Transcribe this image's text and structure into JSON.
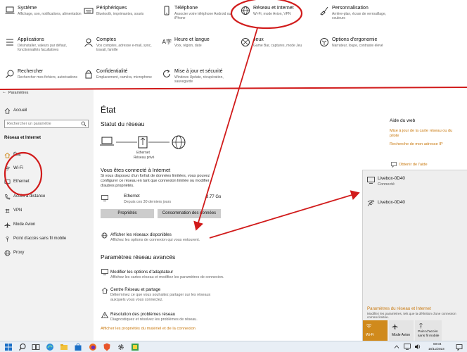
{
  "top_tiles": [
    {
      "title": "Système",
      "desc": "Affichage, son, notifications, alimentation",
      "icon": "laptop-icon"
    },
    {
      "title": "Périphériques",
      "desc": "Bluetooth, imprimantes, souris",
      "icon": "keyboard-icon"
    },
    {
      "title": "Téléphone",
      "desc": "Associer votre téléphone Android ou iPhone",
      "icon": "phone-icon"
    },
    {
      "title": "Réseau et Internet",
      "desc": "Wi-Fi, mode Avion, VPN",
      "icon": "globe-icon"
    },
    {
      "title": "Personnalisation",
      "desc": "Arrière-plan, écran de verrouillage, couleurs",
      "icon": "paintbrush-icon"
    },
    {
      "title": "Applications",
      "desc": "Désinstaller, valeurs par défaut, fonctionnalités facultatives",
      "icon": "apps-icon"
    },
    {
      "title": "Comptes",
      "desc": "Vos comptes, adresse e-mail, sync, travail, famille",
      "icon": "person-icon"
    },
    {
      "title": "Heure et langue",
      "desc": "Voix, région, date",
      "icon": "time-language-icon"
    },
    {
      "title": "Jeux",
      "desc": "Game Bar, captures, mode Jeu",
      "icon": "xbox-icon"
    },
    {
      "title": "Options d'ergonomie",
      "desc": "Narrateur, loupe, contraste élevé",
      "icon": "ease-of-access-icon"
    },
    {
      "title": "Rechercher",
      "desc": "Rechercher mes fichiers, autorisations",
      "icon": "search-icon"
    },
    {
      "title": "Confidentialité",
      "desc": "Emplacement, caméra, microphone",
      "icon": "lock-icon"
    },
    {
      "title": "Mise à jour et sécurité",
      "desc": "Windows Update, récupération, sauvegarde",
      "icon": "refresh-icon"
    }
  ],
  "window": {
    "title": "Paramètres",
    "home_label": "Accueil",
    "search_placeholder": "Rechercher un paramètre",
    "section_label": "Réseau et Internet",
    "nav": [
      {
        "label": "État",
        "icon": "home-status-icon"
      },
      {
        "label": "Wi-Fi",
        "icon": "wifi-icon"
      },
      {
        "label": "Ethernet",
        "icon": "ethernet-icon"
      },
      {
        "label": "Accès à distance",
        "icon": "phone-dial-icon"
      },
      {
        "label": "VPN",
        "icon": "vpn-icon"
      },
      {
        "label": "Mode Avion",
        "icon": "airplane-icon"
      },
      {
        "label": "Point d'accès sans fil mobile",
        "icon": "hotspot-icon"
      },
      {
        "label": "Proxy",
        "icon": "globe-icon"
      }
    ]
  },
  "status": {
    "page_title": "État",
    "network_status_heading": "Statut du réseau",
    "diagram_label_1": "Ethernet",
    "diagram_label_2": "Réseau privé",
    "connected_heading": "Vous êtes connecté à Internet",
    "connected_desc_1": "Si vous disposez d'un forfait de données limitées, vous pouvez",
    "connected_desc_2": "configurer ce réseau en tant que connexion limitée ou modifier",
    "connected_desc_3": "d'autres propriétés.",
    "ethernet_name": "Ethernet",
    "ethernet_since": "Depuis ces 30 derniers jours",
    "ethernet_usage": "8.77 Go",
    "properties_button": "Propriétés",
    "data_usage_button": "Consommation des données",
    "show_networks_title": "Afficher les réseaux disponibles",
    "show_networks_desc": "Affichez les options de connexion qui vous entourent.",
    "advanced_heading": "Paramètres réseau avancés",
    "advanced_items": [
      {
        "title": "Modifier les options d'adaptateur",
        "desc_1": "Affichez les cartes réseau et modifiez les paramètres de connexion.",
        "desc_2": "",
        "icon": "adapter-icon"
      },
      {
        "title": "Centre Réseau et partage",
        "desc_1": "Déterminez ce que vous souhaitez partager sur les réseaux",
        "desc_2": "auxquels vous vous connectez.",
        "icon": "sharing-icon"
      },
      {
        "title": "Résolution des problèmes réseau",
        "desc_1": "Diagnostiquez et résolvez les problèmes de réseau.",
        "desc_2": "",
        "icon": "warning-icon"
      }
    ],
    "hardware_link": "Afficher les propriétés du matériel et de la connexion"
  },
  "help": {
    "heading": "Aide du web",
    "link_1": "Mise à jour de la carte réseau ou du",
    "link_1b": "pilote",
    "link_2": "Recherche de mon adresse IP",
    "get_help": "Obtenir de l'aide"
  },
  "flyout": {
    "networks": [
      {
        "name": "Livebox-0D40",
        "status": "Connecté",
        "icon": "ethernet-monitor-icon"
      },
      {
        "name": "Livebox-0D40",
        "status": "",
        "icon": "wifi-off-icon"
      }
    ],
    "settings_link": "Paramètres du réseau et Internet",
    "settings_desc": "Modifiez les paramètres, tels que la définition d'une connexion comme limitée.",
    "quick_actions": [
      {
        "label": "Wi-Fi",
        "label_2": "",
        "active": true
      },
      {
        "label": "Mode Avion",
        "label_2": "",
        "active": false
      },
      {
        "label": "Point d'accès",
        "label_2": "sans fil mobile",
        "active": false
      }
    ]
  },
  "taskbar": {
    "time": "00:04",
    "date": "16/11/2023"
  },
  "colors": {
    "accent": "#d08a1c",
    "link": "#c9790f",
    "annotation": "#d11b1b",
    "left_pane": "#f2f2f2"
  }
}
